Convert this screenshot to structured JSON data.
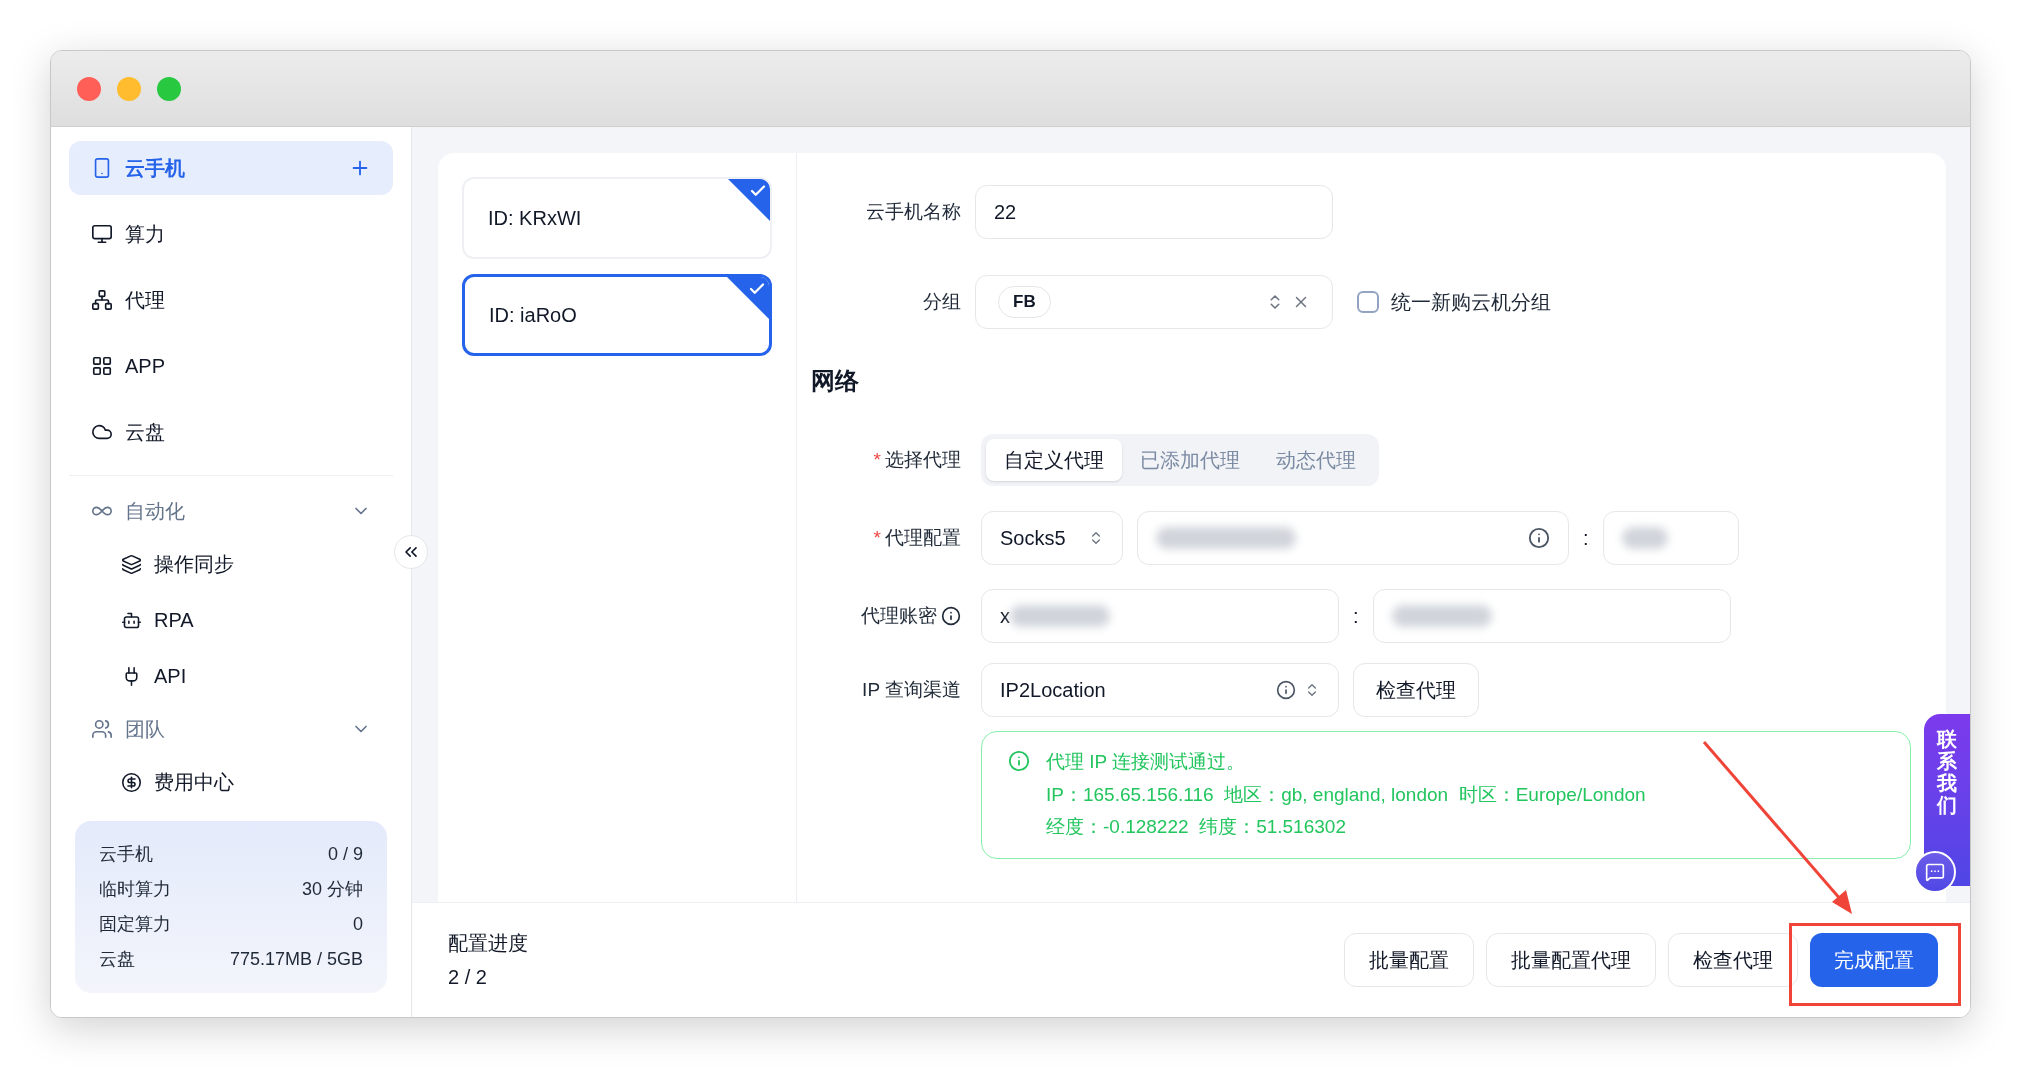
{
  "sidebar": {
    "items": [
      {
        "kind": "item",
        "label": "云手机",
        "selected": true,
        "add": true
      },
      {
        "kind": "item",
        "label": "算力",
        "selected": false
      },
      {
        "kind": "item",
        "label": "代理",
        "selected": false
      },
      {
        "kind": "item",
        "label": "APP",
        "selected": false
      },
      {
        "kind": "item",
        "label": "云盘",
        "selected": false
      },
      {
        "kind": "group",
        "label": "自动化",
        "expanded": true,
        "children": [
          {
            "label": "操作同步",
            "selected": false
          },
          {
            "label": "RPA",
            "selected": false
          },
          {
            "label": "API",
            "selected": false
          }
        ]
      },
      {
        "kind": "group",
        "label": "团队",
        "expanded": true,
        "children": [
          {
            "label": "费用中心",
            "selected": false
          }
        ]
      }
    ],
    "stats": [
      {
        "label": "云手机",
        "value": "0 / 9"
      },
      {
        "label": "临时算力",
        "value": "30 分钟"
      },
      {
        "label": "固定算力",
        "value": "0"
      },
      {
        "label": "云盘",
        "value": "775.17MB / 5GB"
      }
    ]
  },
  "devices": [
    {
      "label": "ID: KRxWI",
      "checked": true,
      "selected": false
    },
    {
      "label": "ID: iaRoO",
      "checked": true,
      "selected": true
    }
  ],
  "form": {
    "name": {
      "label": "云手机名称",
      "value": "22"
    },
    "group": {
      "label": "分组",
      "tag": "FB",
      "checkbox": {
        "label": "统一新购云机分组",
        "checked": false
      }
    },
    "section_title": "网络",
    "proxy_select": {
      "label": "选择代理",
      "required_mark": "*",
      "options": [
        {
          "label": "自定义代理",
          "selected": true
        },
        {
          "label": "已添加代理",
          "selected": false
        },
        {
          "label": "动态代理",
          "selected": false
        }
      ]
    },
    "proxy_config": {
      "label": "代理配置",
      "required_mark": "*",
      "protocol": "Socks5",
      "separator": ":"
    },
    "account": {
      "label": "代理账密",
      "user_value": "x",
      "separator": ":"
    },
    "ip_channel": {
      "label": "IP 查询渠道",
      "value": "IP2Location",
      "button": "检查代理"
    },
    "result": {
      "lines": [
        "代理 IP 连接测试通过。",
        "IP：165.65.156.116  地区：gb, england, london  时区：Europe/London",
        "经度：-0.128222  纬度：51.516302"
      ]
    }
  },
  "footer": {
    "progress_label": "配置进度",
    "progress_value": "2 / 2",
    "buttons": [
      {
        "label": "批量配置",
        "primary": false
      },
      {
        "label": "批量配置代理",
        "primary": false
      },
      {
        "label": "检查代理",
        "primary": false
      },
      {
        "label": "完成配置",
        "primary": true
      }
    ]
  },
  "contact": {
    "label": "联系我们"
  }
}
